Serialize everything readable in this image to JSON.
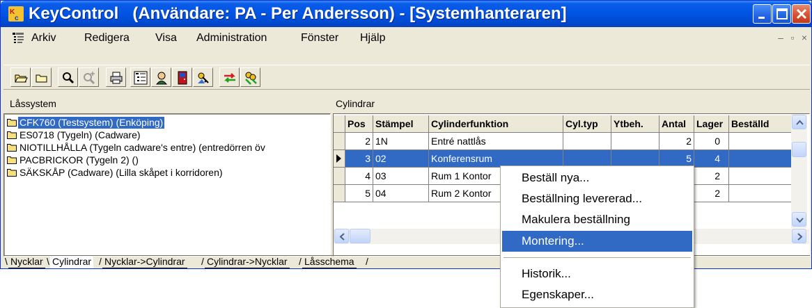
{
  "window": {
    "title": "KeyControl   (Användare: PA - Per Andersson) - [Systemhanteraren]",
    "logo": "key-logo-icon",
    "controls": [
      "minimize-icon",
      "maximize-icon",
      "close-icon"
    ]
  },
  "menubar": {
    "items": [
      "Arkiv",
      "Redigera",
      "Visa",
      "Administration",
      "Fönster",
      "Hjälp"
    ]
  },
  "toolbar": {
    "tools": [
      "open-folder-icon",
      "folder-icon",
      "search-icon",
      "search-plus-icon",
      "print-icon",
      "tree-view-icon",
      "user-icon",
      "door-icon",
      "key-hand-icon",
      "swap-arrows-icon",
      "keys-group-icon"
    ]
  },
  "left_panel": {
    "header": "Låssystem",
    "items": [
      {
        "label": "CFK760 (Testsystem) (Enköping)",
        "selected": true
      },
      {
        "label": "ES0718 (Tygeln) (Cadware)",
        "selected": false
      },
      {
        "label": "NIOTILLHÅLLA (Tygeln cadware's entre) (entredörren öv",
        "selected": false
      },
      {
        "label": "PACBRICKOR (Tygeln 2) ()",
        "selected": false
      },
      {
        "label": "SÄKSKÅP (Cadware) (Lilla skåpet i korridoren)",
        "selected": false
      }
    ]
  },
  "right_panel": {
    "header": "Cylindrar",
    "columns": [
      "Pos",
      "Stämpel",
      "Cylinderfunktion",
      "Cyl.typ",
      "Ytbeh.",
      "Antal",
      "Lager",
      "Beställd"
    ],
    "rows": [
      {
        "pos": "2",
        "stampel": "1N",
        "funktion": "Entré nattlås",
        "cyltyp": "",
        "ytbeh": "",
        "antal": "2",
        "lager": "0",
        "bestalld": "",
        "selected": false
      },
      {
        "pos": "3",
        "stampel": "02",
        "funktion": "Konferensrum",
        "cyltyp": "",
        "ytbeh": "",
        "antal": "5",
        "lager": "4",
        "bestalld": "",
        "selected": true
      },
      {
        "pos": "4",
        "stampel": "03",
        "funktion": "Rum 1 Kontor",
        "cyltyp": "",
        "ytbeh": "",
        "antal": "",
        "lager": "2",
        "bestalld": "",
        "selected": false
      },
      {
        "pos": "5",
        "stampel": "04",
        "funktion": "Rum 2 Kontor",
        "cyltyp": "",
        "ytbeh": "",
        "antal": "",
        "lager": "2",
        "bestalld": "",
        "selected": false
      }
    ]
  },
  "tabs": [
    {
      "label": "Nycklar",
      "active": false
    },
    {
      "label": "Cylindrar",
      "active": true
    },
    {
      "label": "Nycklar->Cylindrar",
      "active": false
    },
    {
      "label": "Cylindrar->Nycklar",
      "active": false
    },
    {
      "label": "Låsschema",
      "active": false
    }
  ],
  "context_menu": {
    "items": [
      {
        "label": "Beställ nya...",
        "highlighted": false
      },
      {
        "label": "Beställning levererad...",
        "highlighted": false
      },
      {
        "label": "Makulera beställning",
        "highlighted": false
      },
      {
        "label": "Montering...",
        "highlighted": true
      },
      {
        "label": "Historik...",
        "highlighted": false
      },
      {
        "label": "Egenskaper...",
        "highlighted": false
      }
    ]
  },
  "colors": {
    "titlebar": "#0054e3",
    "selection": "#316ac5",
    "face": "#ece9d8",
    "close_button": "#d65232"
  }
}
